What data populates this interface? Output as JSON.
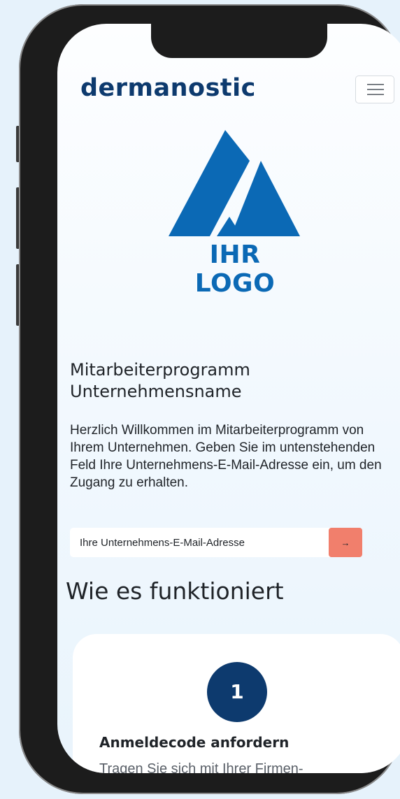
{
  "header": {
    "brand": "dermanostic"
  },
  "logo": {
    "text": "IHR LOGO",
    "color": "#0b69b5"
  },
  "intro": {
    "title_line1": "Mitarbeiterprogramm",
    "title_line2": "Unternehmensname",
    "text": "Herzlich Willkommen im Mitarbeiterprogramm von Ihrem Unternehmen. Geben Sie im untenstehenden Feld Ihre Unternehmens-E-Mail-Adresse ein, um den Zugang zu erhalten."
  },
  "email_form": {
    "placeholder": "Ihre Unternehmens-E-Mail-Adresse",
    "submit_icon": "→"
  },
  "how_it_works": {
    "title": "Wie es funktioniert",
    "steps": [
      {
        "number": "1",
        "title": "Anmeldecode anfordern",
        "text": "Tragen Sie sich mit Ihrer Firmen-"
      }
    ]
  },
  "colors": {
    "brand_navy": "#0d3a6e",
    "accent_coral": "#f17f6c",
    "logo_blue": "#0b69b5"
  },
  "icons": {
    "menu": "hamburger-menu-icon",
    "logo": "mountain-logo-icon",
    "submit": "arrow-right-icon"
  }
}
